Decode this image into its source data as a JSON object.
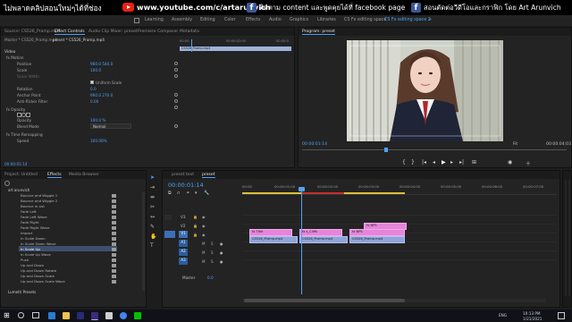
{
  "banner": {
    "left_text": "ไม่พลาดคลิปสอนใหม่ๆได้ที่ช่อง",
    "youtube_url": "www.youtube.com/c/artarunvich",
    "middle_text": "ติดตาม content และพูดคุยได้ที่ facebook page",
    "right_text": "สอนตัดต่อวีดีโอและกราฟิก โดย Art Arunvich",
    "fb_glyph": "f"
  },
  "workspaces": [
    "Learning",
    "Assembly",
    "Editing",
    "Color",
    "Effects",
    "Audio",
    "Graphics",
    "Libraries",
    "CS Fx editing space",
    "CS Fx editing space 2"
  ],
  "active_workspace_index": 9,
  "source_panel": {
    "tabs": [
      "Source: CS526_Pramp.mp4",
      "Effect Controls",
      "Audio Clip Mixer: preset",
      "Premiere Composer",
      "Metadata"
    ],
    "active_tab_index": 1,
    "breadcrumb_master": "Master * CS526_Pramp.mp4",
    "breadcrumb_clip": "preset * CS526_Pramp.mp4",
    "mini_clip_label": "CS526_Pramp.mp4",
    "mini_timecodes": [
      "00:00",
      "00:00:02:00",
      "00:00:0"
    ],
    "section_video": "Video",
    "rows": [
      {
        "label": "fx  Motion",
        "value": ""
      },
      {
        "label": "Position",
        "value": "960.0    540.0"
      },
      {
        "label": "Scale",
        "value": "100.0"
      },
      {
        "label": "Scale Width",
        "value": ""
      },
      {
        "label": "",
        "value": "Uniform Scale"
      },
      {
        "label": "Rotation",
        "value": "0.0"
      },
      {
        "label": "Anchor Point",
        "value": "960.0    270.0"
      },
      {
        "label": "Anti-flicker Filter",
        "value": "0.00"
      },
      {
        "label": "fx  Opacity",
        "value": ""
      },
      {
        "label": "Opacity",
        "value": "100.0 %"
      },
      {
        "label": "Blend Mode",
        "value": "Normal"
      },
      {
        "label": "fx  Time Remapping",
        "value": ""
      },
      {
        "label": "Speed",
        "value": "100.00%"
      }
    ],
    "footer_timecode": "00:00:01:14"
  },
  "program_panel": {
    "title": "Program: preset",
    "timecode": "00:00:01:14",
    "fit": "Fit",
    "duration": "00:00:04:03"
  },
  "project_panel": {
    "tabs": [
      "Project: Untitled",
      "Effects",
      "Media Browser"
    ],
    "active_tab_index": 1,
    "folder": "art arunvich",
    "items": [
      "Bounce and Wiggle 1",
      "Bounce and Wiggle 2",
      "Bounce in out",
      "Fade Left",
      "Fade Left Wave",
      "Fade Right",
      "Fade Right Wave",
      "Impact",
      "In Scale Down",
      "In Scale Down Wave",
      "In Scale Up",
      "In Scale Up Wave",
      "Push",
      "Up and Down",
      "Up and Down Rotate",
      "Up and Down Scale",
      "Up and Down Scale Wave"
    ],
    "selected_index": 10,
    "footer_folder": "Lumetri Presets"
  },
  "timeline": {
    "tabs": [
      "preset text",
      "preset"
    ],
    "active_tab_index": 1,
    "timecode": "00:00:01:14",
    "ruler": [
      "00:00",
      "00:00:01:00",
      "00:00:02:00",
      "00:00:03:00",
      "00:00:04:00",
      "00:00:05:00",
      "00:00:06:00",
      "00:00:07:00"
    ],
    "tracks": [
      "V3",
      "V2",
      "V1",
      "A1",
      "A2",
      "A3"
    ],
    "master_label": "Master",
    "master_value": "0.0",
    "clips": [
      {
        "label": "fx  NPS",
        "color": "pink"
      },
      {
        "label": "fx  Title",
        "color": "pink"
      },
      {
        "label": "fx  s_Cliffs",
        "color": "pink"
      },
      {
        "label": "fx  NPS",
        "color": "pink"
      },
      {
        "label": "CS526_Pramp.mp4",
        "color": "blue"
      },
      {
        "label": "CS526_Pramp.mp4",
        "color": "blue"
      },
      {
        "label": "CS526_Pramp.mp4",
        "color": "blue"
      }
    ]
  },
  "taskbar": {
    "time": "10:13 PM",
    "date": "1/21/2021",
    "lang": "ENG"
  },
  "colors": {
    "accent": "#4fa3f7",
    "clip_pink": "#e485d9",
    "clip_blue": "#8fa3d9",
    "youtube_red": "#e62117",
    "facebook_blue": "#3b5998"
  }
}
